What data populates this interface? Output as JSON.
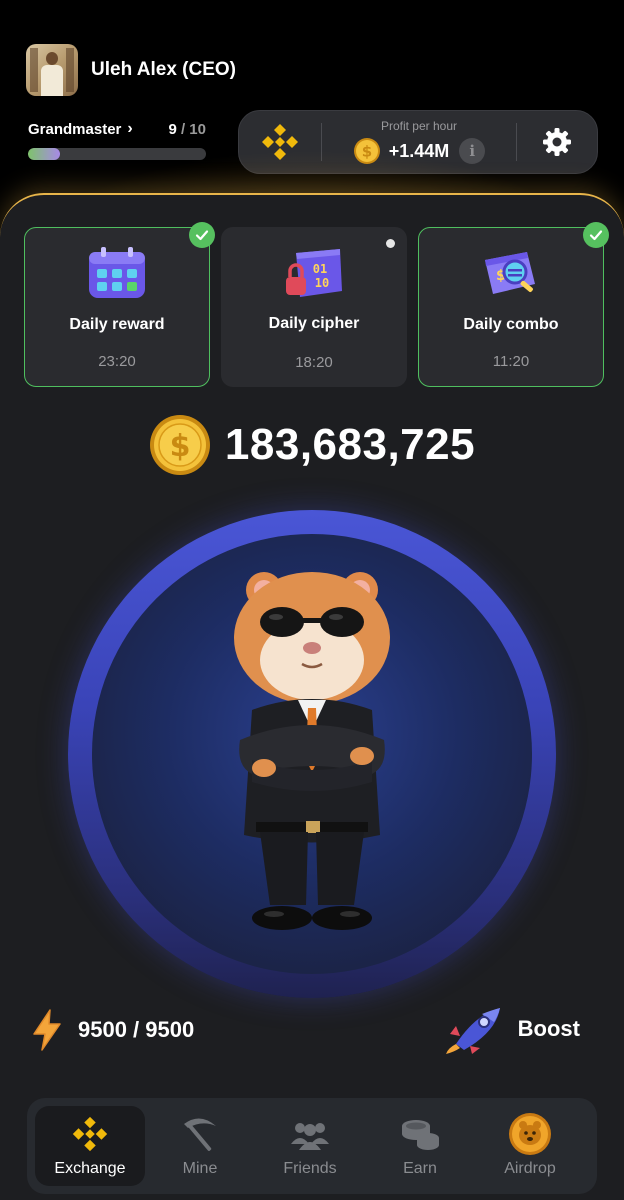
{
  "user": {
    "name": "Uleh Alex (CEO)"
  },
  "level": {
    "name": "Grandmaster",
    "current": "9",
    "total": "/ 10",
    "progress_fraction": 0.18
  },
  "profit": {
    "label": "Profit per hour",
    "value": "+1.44M"
  },
  "daily": [
    {
      "title": "Daily reward",
      "time": "23:20",
      "completed": true
    },
    {
      "title": "Daily cipher",
      "time": "18:20",
      "completed": false
    },
    {
      "title": "Daily combo",
      "time": "11:20",
      "completed": true
    }
  ],
  "balance": {
    "value": "183,683,725"
  },
  "energy": {
    "value": "9500 / 9500"
  },
  "boost": {
    "label": "Boost"
  },
  "nav": [
    {
      "label": "Exchange",
      "icon": "binance-icon",
      "active": true
    },
    {
      "label": "Mine",
      "icon": "pickaxe-icon",
      "active": false
    },
    {
      "label": "Friends",
      "icon": "friends-icon",
      "active": false
    },
    {
      "label": "Earn",
      "icon": "coins-icon",
      "active": false
    },
    {
      "label": "Airdrop",
      "icon": "hamster-coin-icon",
      "active": false
    }
  ],
  "colors": {
    "accent_gold": "#e8b54a",
    "check_green": "#56c05f",
    "circle_blue": "#4a56d6",
    "binance_yellow": "#f0b90b"
  }
}
